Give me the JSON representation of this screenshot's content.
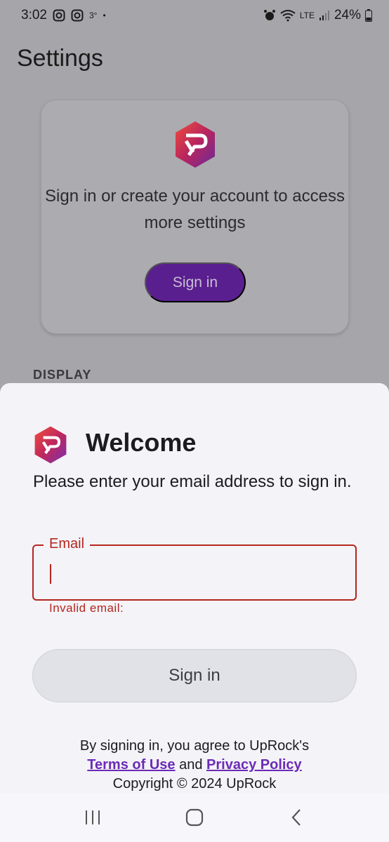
{
  "status_bar": {
    "time": "3:02",
    "temperature": "3°",
    "dot": "•",
    "battery": "24%",
    "network": "LTE"
  },
  "settings": {
    "title": "Settings",
    "card": {
      "text": "Sign in or create your account to access more settings",
      "signin_label": "Sign in"
    },
    "section_display": "DISPLAY"
  },
  "sheet": {
    "title": "Welcome",
    "description": "Please enter your email address to sign in.",
    "email_label": "Email",
    "email_value": "",
    "email_error": "Invalid email:",
    "signin_label": "Sign in",
    "legal_prefix": "By signing in, you agree to UpRock's",
    "terms_link": "Terms of Use",
    "and_text": "and",
    "privacy_link": "Privacy Policy",
    "copyright": "Copyright © 2024 UpRock"
  },
  "colors": {
    "brand_purple": "#5a1f8f",
    "error_red": "#b3261e",
    "link_purple": "#6b2bb7",
    "sheet_bg": "#f4f3f8"
  },
  "icons": {
    "instagram": "instagram-icon",
    "alarm": "alarm-icon",
    "wifi": "wifi-icon",
    "signal": "signal-icon",
    "battery": "battery-icon",
    "logo": "uprock-logo-icon",
    "recents": "recents-icon",
    "home": "home-icon",
    "back": "back-icon"
  }
}
